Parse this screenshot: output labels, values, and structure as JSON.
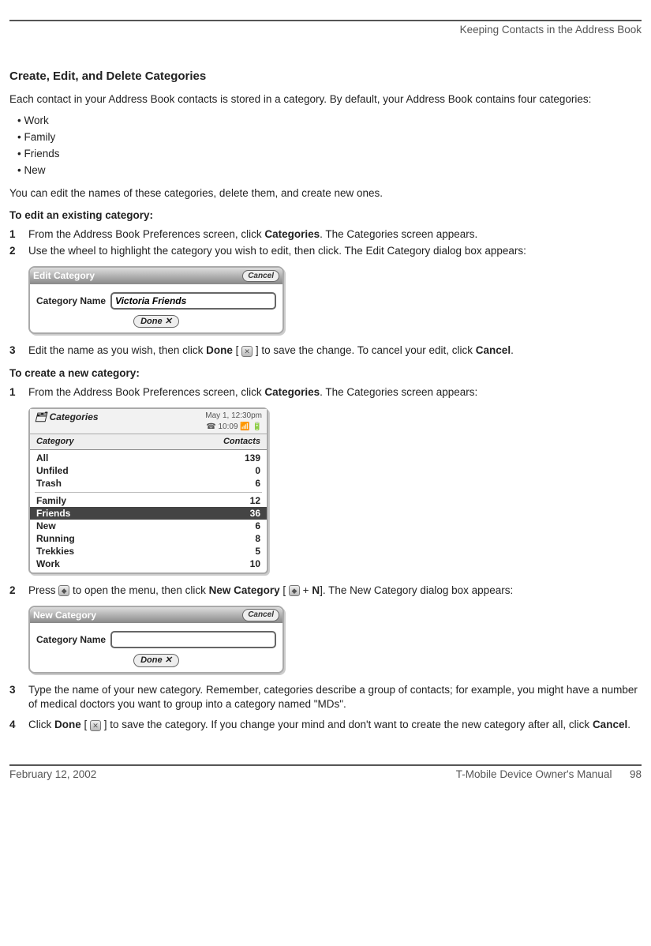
{
  "header": {
    "chapter": "Keeping Contacts in the Address Book"
  },
  "section_title": "Create, Edit, and Delete Categories",
  "intro": "Each contact in your Address Book contacts is stored in a category. By default, your Address Book contains four categories:",
  "default_categories": [
    "Work",
    "Family",
    "Friends",
    "New"
  ],
  "after_bullets": "You can edit the names of these categories, delete them, and create new ones.",
  "edit_heading": "To edit an existing category",
  "edit_steps": {
    "s1": {
      "pre": "From the Address Book Preferences screen, click ",
      "b1": "Categories",
      "post": ". The Categories screen appears."
    },
    "s2": "Use the wheel to highlight the category you wish to edit, then click. The Edit Category dialog box appears:",
    "s3": {
      "pre": "Edit the name as you wish, then click ",
      "b1": "Done",
      "mid": " [ ",
      "postmid": " ] to save the change. To cancel your edit, click ",
      "b2": "Cancel",
      "end": "."
    }
  },
  "edit_dialog": {
    "title": "Edit Category",
    "cancel": "Cancel",
    "label": "Category Name",
    "value": "Victoria Friends",
    "done": "Done ✕"
  },
  "create_heading": "To create a new category",
  "create_steps": {
    "s1": {
      "pre": "From the Address Book Preferences screen, click ",
      "b1": "Categories",
      "post": ". The Categories screen appears:"
    },
    "s2": {
      "pre": "Press ",
      "mid": " to open the menu, then click ",
      "b1": "New Category",
      "mid2": " [ ",
      "plus": " + ",
      "nkey": "N",
      "post": "]. The New Category dialog box appears:"
    },
    "s3": "Type the name of your new category. Remember, categories describe a group of contacts; for example, you might have a number of medical doctors you want to group into a category named \"MDs\".",
    "s4": {
      "pre": "Click ",
      "b1": "Done",
      "mid": " [ ",
      "postmid": " ] to save the category. If you change your mind and don't want to create the new category after all, click ",
      "b2": "Cancel",
      "end": "."
    }
  },
  "categories_screen": {
    "crumb": "Categories",
    "date": "May 1, 12:30pm",
    "time": "10:09",
    "col1": "Category",
    "col2": "Contacts",
    "rows_top": [
      {
        "name": "All",
        "count": "139"
      },
      {
        "name": "Unfiled",
        "count": "0"
      },
      {
        "name": "Trash",
        "count": "6"
      }
    ],
    "rows_bottom": [
      {
        "name": "Family",
        "count": "12",
        "selected": false
      },
      {
        "name": "Friends",
        "count": "36",
        "selected": true
      },
      {
        "name": "New",
        "count": "6",
        "selected": false
      },
      {
        "name": "Running",
        "count": "8",
        "selected": false
      },
      {
        "name": "Trekkies",
        "count": "5",
        "selected": false
      },
      {
        "name": "Work",
        "count": "10",
        "selected": false
      }
    ]
  },
  "new_dialog": {
    "title": "New Category",
    "cancel": "Cancel",
    "label": "Category Name",
    "value": "",
    "done": "Done ✕"
  },
  "footer": {
    "date": "February 12, 2002",
    "title": "T-Mobile Device Owner's Manual",
    "page": "98"
  }
}
